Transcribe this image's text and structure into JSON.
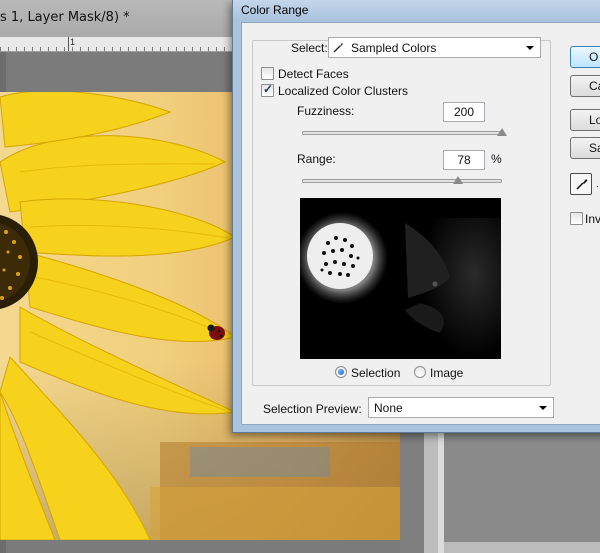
{
  "document": {
    "tab_title": "s 1, Layer Mask/8) *",
    "ruler_mark": "1"
  },
  "dialog": {
    "title": "Color Range",
    "select": {
      "label": "Select:",
      "value": "Sampled Colors",
      "icon": "eyedropper-icon"
    },
    "detect_faces": {
      "label": "Detect Faces",
      "checked": false
    },
    "localized_color_clusters": {
      "label": "Localized Color Clusters",
      "checked": true
    },
    "fuzziness": {
      "label": "Fuzziness:",
      "value": "200",
      "slider_fraction": 1.0
    },
    "range": {
      "label": "Range:",
      "value": "78",
      "unit": "%",
      "slider_fraction": 0.78
    },
    "view_options": [
      {
        "label": "Selection",
        "selected": true
      },
      {
        "label": "Image",
        "selected": false
      }
    ],
    "selection_preview": {
      "label": "Selection Preview:",
      "value": "None"
    },
    "buttons": {
      "ok": "O",
      "cancel": "Ca",
      "load": "Lo",
      "save": "Sa"
    },
    "invert": {
      "label": "Inv",
      "checked": false
    }
  }
}
